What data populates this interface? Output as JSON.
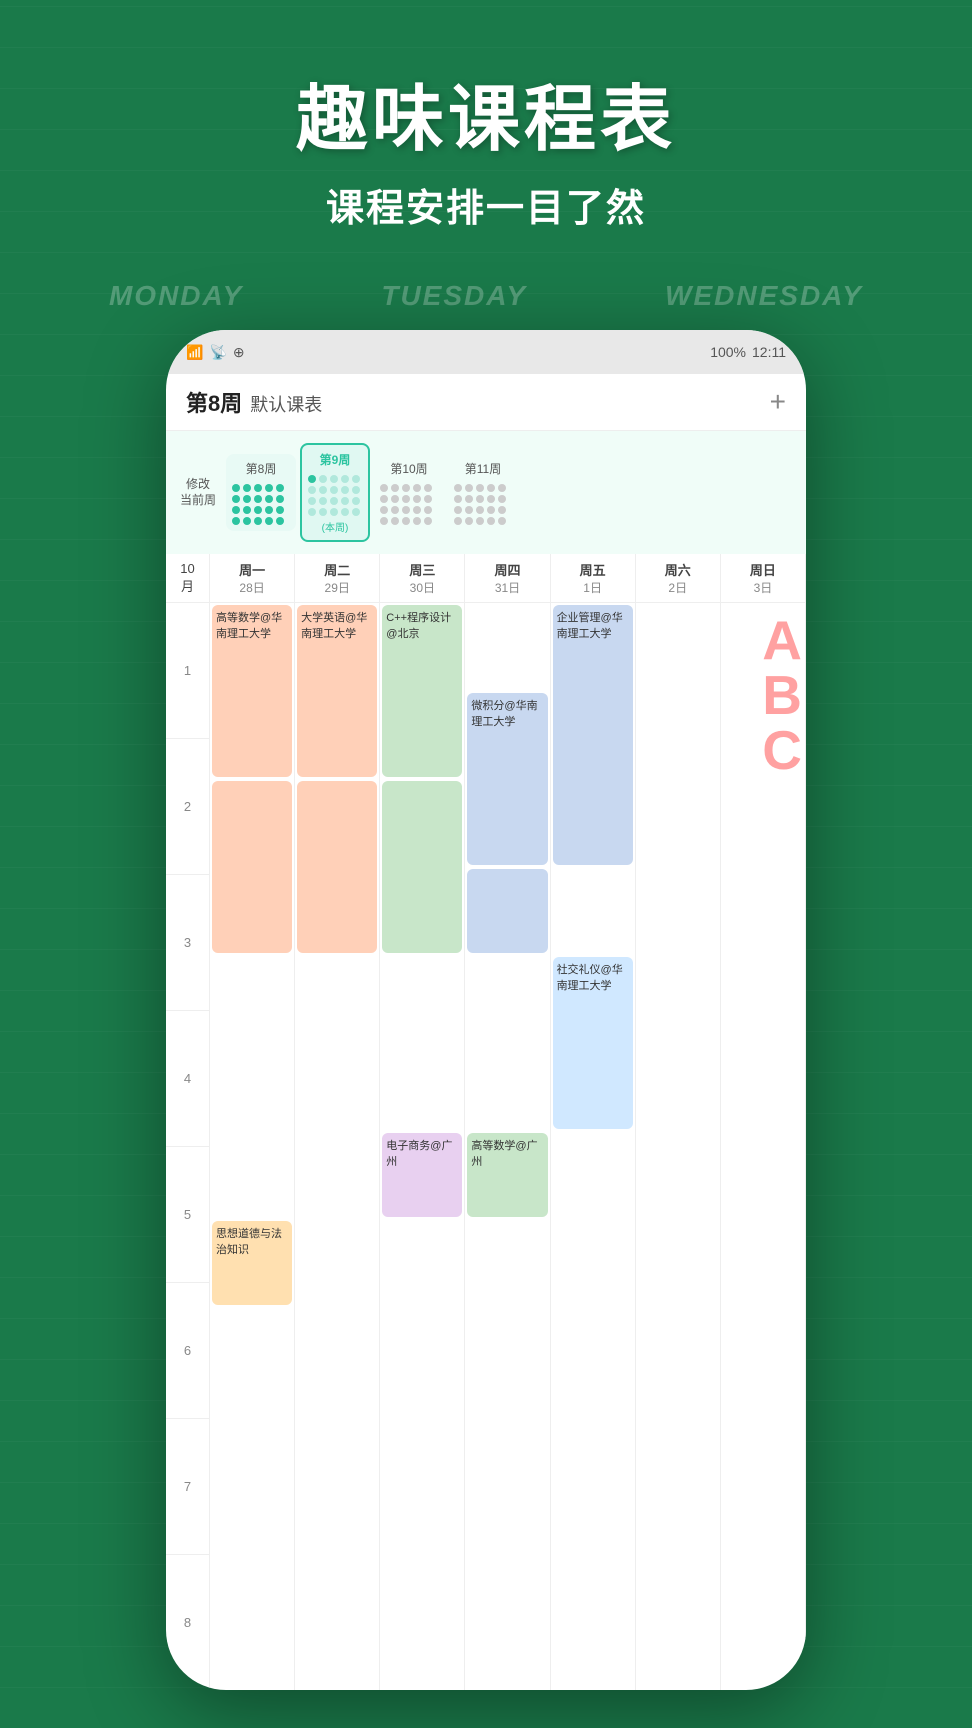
{
  "background": {
    "color": "#1a7a4a",
    "day_labels": [
      "MONDAY",
      "TUESDAY",
      "WEDNESDAY"
    ]
  },
  "header": {
    "title": "趣味课程表",
    "subtitle": "课程安排一目了然"
  },
  "status_bar": {
    "signal": "📶",
    "wifi": "WiFi",
    "battery": "100%",
    "time": "12:11"
  },
  "app_header": {
    "week_label": "第8周",
    "schedule_name": "默认课表",
    "add_button": "+"
  },
  "week_selector": {
    "label_line1": "修改",
    "label_line2": "当前周",
    "weeks": [
      {
        "name": "第8周",
        "is_current": false,
        "dot_type": "teal"
      },
      {
        "name": "第9周",
        "is_current": true,
        "current_text": "(本周)",
        "dot_type": "mixed"
      },
      {
        "name": "第10周",
        "is_current": false,
        "dot_type": "gray"
      },
      {
        "name": "第11周",
        "is_current": false,
        "dot_type": "gray"
      }
    ]
  },
  "calendar": {
    "month": "10\n月",
    "days": [
      {
        "name": "周一",
        "date": "28日"
      },
      {
        "name": "周二",
        "date": "29日"
      },
      {
        "name": "周三",
        "date": "30日"
      },
      {
        "name": "周四",
        "date": "31日"
      },
      {
        "name": "周五",
        "date": "1日"
      },
      {
        "name": "周六",
        "date": "2日"
      },
      {
        "name": "周日",
        "date": "3日"
      }
    ],
    "periods": [
      "1",
      "2",
      "3",
      "4",
      "5",
      "6",
      "7",
      "8"
    ],
    "courses": [
      {
        "day": 0,
        "period_start": 1,
        "period_span": 2,
        "text": "高等数学@华南理工大学",
        "color": "#ffd0b8"
      },
      {
        "day": 1,
        "period_start": 1,
        "period_span": 2,
        "text": "大学英语@华南理工大学",
        "color": "#ffd0b8"
      },
      {
        "day": 2,
        "period_start": 1,
        "period_span": 2,
        "text": "C++程序设计@北京",
        "color": "#c8e6c9"
      },
      {
        "day": 3,
        "period_start": 2,
        "period_span": 2,
        "text": "微积分@华南理工大学",
        "color": "#c8d8f0"
      },
      {
        "day": 4,
        "period_start": 1,
        "period_span": 3,
        "text": "企业管理@华南理工大学",
        "color": "#c8d8f0"
      },
      {
        "day": 0,
        "period_start": 3,
        "period_span": 2,
        "text": "",
        "color": "#ffd0b8"
      },
      {
        "day": 1,
        "period_start": 3,
        "period_span": 2,
        "text": "",
        "color": "#ffd0b8"
      },
      {
        "day": 2,
        "period_start": 3,
        "period_span": 2,
        "text": "",
        "color": "#c8e6c9"
      },
      {
        "day": 3,
        "period_start": 4,
        "period_span": 1,
        "text": "",
        "color": "#c8d8f0"
      },
      {
        "day": 4,
        "period_start": 5,
        "period_span": 2,
        "text": "社交礼仪@华南理工大学",
        "color": "#d0e8ff"
      },
      {
        "day": 2,
        "period_start": 7,
        "period_span": 1,
        "text": "电子商务@广州",
        "color": "#e8d0f0"
      },
      {
        "day": 3,
        "period_start": 7,
        "period_span": 1,
        "text": "高等数学@广州",
        "color": "#c8e6c9"
      },
      {
        "day": 0,
        "period_start": 8,
        "period_span": 1,
        "text": "思想道德与法治知识",
        "color": "#ffe0b0"
      }
    ]
  }
}
